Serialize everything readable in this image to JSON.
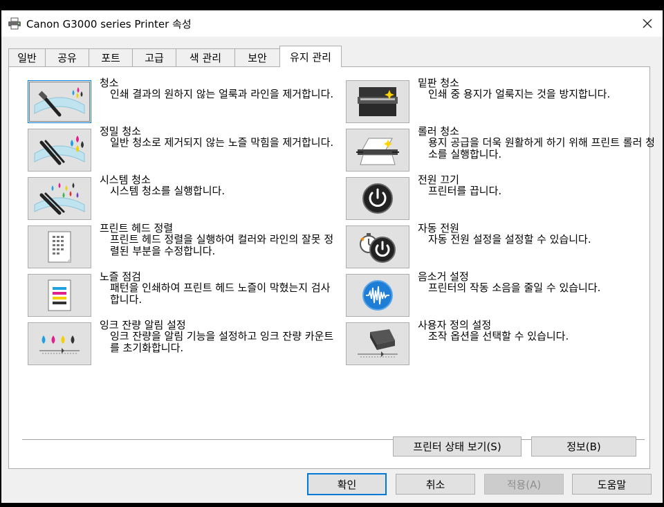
{
  "window": {
    "title": "Canon G3000 series Printer 속성"
  },
  "tabs": [
    {
      "label": "일반"
    },
    {
      "label": "공유"
    },
    {
      "label": "포트"
    },
    {
      "label": "고급"
    },
    {
      "label": "색 관리"
    },
    {
      "label": "보안"
    },
    {
      "label": "유지 관리"
    }
  ],
  "active_tab": "유지 관리",
  "left_items": [
    {
      "title": "청소",
      "desc": "인쇄 결과의 원하지 않는 얼룩과 라인을 제거합니다.",
      "icon": "cleaning-icon"
    },
    {
      "title": "정밀 청소",
      "desc": "일반 청소로 제거되지 않는 노즐 막힘을 제거합니다.",
      "icon": "deep-cleaning-icon"
    },
    {
      "title": "시스템 청소",
      "desc": "시스템 청소를 실행합니다.",
      "icon": "system-cleaning-icon"
    },
    {
      "title": "프린트 헤드 정렬",
      "desc": "프린트 헤드 정렬을 실행하여 컬러와 라인의 잘못 정렬된 부분을 수정합니다.",
      "icon": "head-alignment-icon"
    },
    {
      "title": "노즐 점검",
      "desc": "패턴을 인쇄하여 프린트 헤드 노즐이 막혔는지 검사합니다.",
      "icon": "nozzle-check-icon"
    },
    {
      "title": "잉크 잔량 알림 설정",
      "desc": "잉크 잔량을 알림 기능을 설정하고 잉크 잔량 카운트를 초기화합니다.",
      "icon": "ink-level-icon"
    }
  ],
  "right_items": [
    {
      "title": "밑판 청소",
      "desc": "인쇄 중 용지가 얼룩지는 것을 방지합니다.",
      "icon": "bottom-plate-cleaning-icon"
    },
    {
      "title": "롤러 청소",
      "desc": "용지 공급을 더욱 원활하게 하기 위해 프린트 롤러 청소를 실행합니다.",
      "icon": "roller-cleaning-icon"
    },
    {
      "title": "전원 끄기",
      "desc": "프린터를 끕니다.",
      "icon": "power-off-icon"
    },
    {
      "title": "자동 전원",
      "desc": "자동 전원 설정을 설정할 수 있습니다.",
      "icon": "auto-power-icon"
    },
    {
      "title": "음소거 설정",
      "desc": "프린터의 작동 소음을 줄일 수 있습니다.",
      "icon": "quiet-mode-icon"
    },
    {
      "title": "사용자 정의 설정",
      "desc": "조작 옵션을 선택할 수 있습니다.",
      "icon": "custom-settings-icon"
    }
  ],
  "panel_buttons": {
    "status": "프린터 상태 보기(S)",
    "about": "정보(B)"
  },
  "dialog_buttons": {
    "ok": "확인",
    "cancel": "취소",
    "apply": "적용(A)",
    "help": "도움말"
  }
}
